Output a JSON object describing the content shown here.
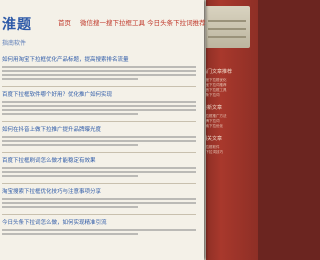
{
  "header": {
    "logo": "淮题",
    "subtitle": "指南软件",
    "nav": [
      {
        "label": "首页"
      },
      {
        "label": "微信搜一搜下拉框工具 今日头条下拉词推荐"
      }
    ]
  },
  "articles": [
    {
      "title": "如何用淘宝下拉框优化产品标题，提高搜索排名流量"
    },
    {
      "title": "百度下拉框软件哪个好用？优化推广如何实现"
    },
    {
      "title": "如何在抖音上做下拉推广提升品牌曝光度"
    },
    {
      "title": "百度下拉框刷词怎么做才能稳定有效果"
    },
    {
      "title": "淘宝搜索下拉框优化技巧与注意事项分享"
    },
    {
      "title": "今日头条下拉词怎么做，如何实现精准引流"
    }
  ],
  "sidebar": {
    "sections": [
      {
        "title": "热门文章推荐",
        "items": [
          "百度下拉框优化",
          "淘宝下拉词推荐",
          "抖音下拉框工具",
          "头条下拉词"
        ]
      },
      {
        "title": "最新文章",
        "items": [
          "下拉框推广方法",
          "品牌下拉词",
          "搜索下拉优化"
        ]
      },
      {
        "title": "相关文章",
        "items": [
          "下拉框软件",
          "刷下拉词技巧"
        ]
      }
    ]
  }
}
